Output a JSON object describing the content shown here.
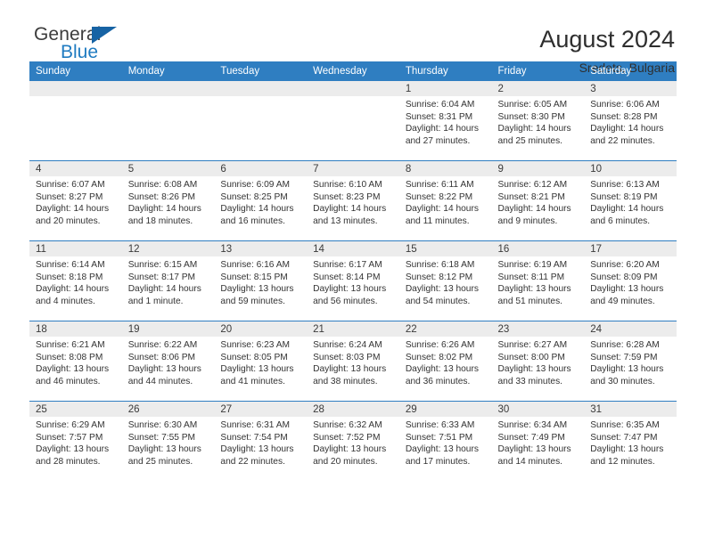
{
  "brand": {
    "name_part1": "General",
    "name_part2": "Blue",
    "flag_icon": "triangle-flag-icon"
  },
  "header": {
    "title": "August 2024",
    "subtitle": "Sredets, Bulgaria"
  },
  "theme": {
    "header_blue": "#2f7ec1",
    "band_gray": "#ececec",
    "brand_blue": "#1f7bc1",
    "text": "#333333"
  },
  "columns": [
    "Sunday",
    "Monday",
    "Tuesday",
    "Wednesday",
    "Thursday",
    "Friday",
    "Saturday"
  ],
  "weeks": [
    [
      {
        "day": "",
        "lines": []
      },
      {
        "day": "",
        "lines": []
      },
      {
        "day": "",
        "lines": []
      },
      {
        "day": "",
        "lines": []
      },
      {
        "day": "1",
        "lines": [
          "Sunrise: 6:04 AM",
          "Sunset: 8:31 PM",
          "Daylight: 14 hours",
          "and 27 minutes."
        ]
      },
      {
        "day": "2",
        "lines": [
          "Sunrise: 6:05 AM",
          "Sunset: 8:30 PM",
          "Daylight: 14 hours",
          "and 25 minutes."
        ]
      },
      {
        "day": "3",
        "lines": [
          "Sunrise: 6:06 AM",
          "Sunset: 8:28 PM",
          "Daylight: 14 hours",
          "and 22 minutes."
        ]
      }
    ],
    [
      {
        "day": "4",
        "lines": [
          "Sunrise: 6:07 AM",
          "Sunset: 8:27 PM",
          "Daylight: 14 hours",
          "and 20 minutes."
        ]
      },
      {
        "day": "5",
        "lines": [
          "Sunrise: 6:08 AM",
          "Sunset: 8:26 PM",
          "Daylight: 14 hours",
          "and 18 minutes."
        ]
      },
      {
        "day": "6",
        "lines": [
          "Sunrise: 6:09 AM",
          "Sunset: 8:25 PM",
          "Daylight: 14 hours",
          "and 16 minutes."
        ]
      },
      {
        "day": "7",
        "lines": [
          "Sunrise: 6:10 AM",
          "Sunset: 8:23 PM",
          "Daylight: 14 hours",
          "and 13 minutes."
        ]
      },
      {
        "day": "8",
        "lines": [
          "Sunrise: 6:11 AM",
          "Sunset: 8:22 PM",
          "Daylight: 14 hours",
          "and 11 minutes."
        ]
      },
      {
        "day": "9",
        "lines": [
          "Sunrise: 6:12 AM",
          "Sunset: 8:21 PM",
          "Daylight: 14 hours",
          "and 9 minutes."
        ]
      },
      {
        "day": "10",
        "lines": [
          "Sunrise: 6:13 AM",
          "Sunset: 8:19 PM",
          "Daylight: 14 hours",
          "and 6 minutes."
        ]
      }
    ],
    [
      {
        "day": "11",
        "lines": [
          "Sunrise: 6:14 AM",
          "Sunset: 8:18 PM",
          "Daylight: 14 hours",
          "and 4 minutes."
        ]
      },
      {
        "day": "12",
        "lines": [
          "Sunrise: 6:15 AM",
          "Sunset: 8:17 PM",
          "Daylight: 14 hours",
          "and 1 minute."
        ]
      },
      {
        "day": "13",
        "lines": [
          "Sunrise: 6:16 AM",
          "Sunset: 8:15 PM",
          "Daylight: 13 hours",
          "and 59 minutes."
        ]
      },
      {
        "day": "14",
        "lines": [
          "Sunrise: 6:17 AM",
          "Sunset: 8:14 PM",
          "Daylight: 13 hours",
          "and 56 minutes."
        ]
      },
      {
        "day": "15",
        "lines": [
          "Sunrise: 6:18 AM",
          "Sunset: 8:12 PM",
          "Daylight: 13 hours",
          "and 54 minutes."
        ]
      },
      {
        "day": "16",
        "lines": [
          "Sunrise: 6:19 AM",
          "Sunset: 8:11 PM",
          "Daylight: 13 hours",
          "and 51 minutes."
        ]
      },
      {
        "day": "17",
        "lines": [
          "Sunrise: 6:20 AM",
          "Sunset: 8:09 PM",
          "Daylight: 13 hours",
          "and 49 minutes."
        ]
      }
    ],
    [
      {
        "day": "18",
        "lines": [
          "Sunrise: 6:21 AM",
          "Sunset: 8:08 PM",
          "Daylight: 13 hours",
          "and 46 minutes."
        ]
      },
      {
        "day": "19",
        "lines": [
          "Sunrise: 6:22 AM",
          "Sunset: 8:06 PM",
          "Daylight: 13 hours",
          "and 44 minutes."
        ]
      },
      {
        "day": "20",
        "lines": [
          "Sunrise: 6:23 AM",
          "Sunset: 8:05 PM",
          "Daylight: 13 hours",
          "and 41 minutes."
        ]
      },
      {
        "day": "21",
        "lines": [
          "Sunrise: 6:24 AM",
          "Sunset: 8:03 PM",
          "Daylight: 13 hours",
          "and 38 minutes."
        ]
      },
      {
        "day": "22",
        "lines": [
          "Sunrise: 6:26 AM",
          "Sunset: 8:02 PM",
          "Daylight: 13 hours",
          "and 36 minutes."
        ]
      },
      {
        "day": "23",
        "lines": [
          "Sunrise: 6:27 AM",
          "Sunset: 8:00 PM",
          "Daylight: 13 hours",
          "and 33 minutes."
        ]
      },
      {
        "day": "24",
        "lines": [
          "Sunrise: 6:28 AM",
          "Sunset: 7:59 PM",
          "Daylight: 13 hours",
          "and 30 minutes."
        ]
      }
    ],
    [
      {
        "day": "25",
        "lines": [
          "Sunrise: 6:29 AM",
          "Sunset: 7:57 PM",
          "Daylight: 13 hours",
          "and 28 minutes."
        ]
      },
      {
        "day": "26",
        "lines": [
          "Sunrise: 6:30 AM",
          "Sunset: 7:55 PM",
          "Daylight: 13 hours",
          "and 25 minutes."
        ]
      },
      {
        "day": "27",
        "lines": [
          "Sunrise: 6:31 AM",
          "Sunset: 7:54 PM",
          "Daylight: 13 hours",
          "and 22 minutes."
        ]
      },
      {
        "day": "28",
        "lines": [
          "Sunrise: 6:32 AM",
          "Sunset: 7:52 PM",
          "Daylight: 13 hours",
          "and 20 minutes."
        ]
      },
      {
        "day": "29",
        "lines": [
          "Sunrise: 6:33 AM",
          "Sunset: 7:51 PM",
          "Daylight: 13 hours",
          "and 17 minutes."
        ]
      },
      {
        "day": "30",
        "lines": [
          "Sunrise: 6:34 AM",
          "Sunset: 7:49 PM",
          "Daylight: 13 hours",
          "and 14 minutes."
        ]
      },
      {
        "day": "31",
        "lines": [
          "Sunrise: 6:35 AM",
          "Sunset: 7:47 PM",
          "Daylight: 13 hours",
          "and 12 minutes."
        ]
      }
    ]
  ]
}
